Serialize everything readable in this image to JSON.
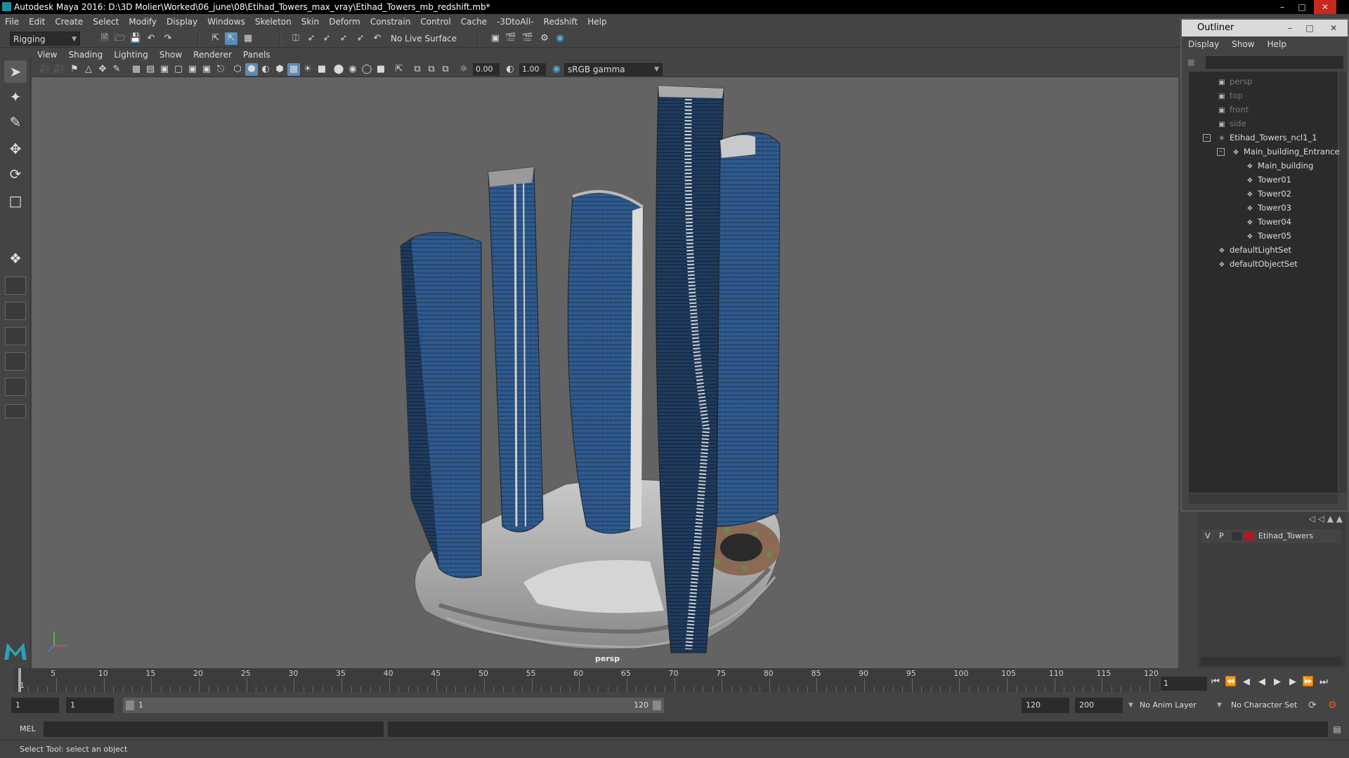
{
  "window": {
    "title": "Autodesk Maya 2016: D:\\3D Molier\\Worked\\06_june\\08\\Etihad_Towers_max_vray\\Etihad_Towers_mb_redshift.mb*"
  },
  "menubar": [
    "File",
    "Edit",
    "Create",
    "Select",
    "Modify",
    "Display",
    "Windows",
    "Skeleton",
    "Skin",
    "Deform",
    "Constrain",
    "Control",
    "Cache",
    "-3DtoAll-",
    "Redshift",
    "Help"
  ],
  "statusline": {
    "mode": "Rigging",
    "live_surface": "No Live Surface"
  },
  "viewport": {
    "menus": [
      "View",
      "Shading",
      "Lighting",
      "Show",
      "Renderer",
      "Panels"
    ],
    "exposure": "0.00",
    "gamma": "1.00",
    "colorspace": "sRGB gamma",
    "camera": "persp",
    "background": "#636363",
    "glass_color": "#2f5b8f"
  },
  "outliner": {
    "title": "Outliner",
    "menus": [
      "Display",
      "Show",
      "Help"
    ],
    "items": [
      {
        "label": "persp",
        "icon": "camera-icon"
      },
      {
        "label": "top",
        "icon": "camera-icon"
      },
      {
        "label": "front",
        "icon": "camera-icon"
      },
      {
        "label": "side",
        "icon": "camera-icon"
      },
      {
        "label": "Etihad_Towers_ncl1_1",
        "icon": "locator-icon"
      },
      {
        "label": "Main_building_Entrance",
        "icon": "group-icon"
      },
      {
        "label": "Main_building",
        "icon": "group-icon"
      },
      {
        "label": "Tower01",
        "icon": "group-icon"
      },
      {
        "label": "Tower02",
        "icon": "group-icon"
      },
      {
        "label": "Tower03",
        "icon": "group-icon"
      },
      {
        "label": "Tower04",
        "icon": "group-icon"
      },
      {
        "label": "Tower05",
        "icon": "group-icon"
      },
      {
        "label": "defaultLightSet",
        "icon": "set-icon"
      },
      {
        "label": "defaultObjectSet",
        "icon": "set-icon"
      }
    ]
  },
  "layers": {
    "v": "V",
    "p": "P",
    "name": "Etihad_Towers",
    "color": "#b5162b"
  },
  "timeline": {
    "ticks": [
      "1",
      "5",
      "10",
      "15",
      "20",
      "25",
      "30",
      "35",
      "40",
      "45",
      "50",
      "55",
      "60",
      "65",
      "70",
      "75",
      "80",
      "85",
      "90",
      "95",
      "100",
      "105",
      "110",
      "115",
      "120"
    ],
    "current_frame": "1"
  },
  "range": {
    "start": "1",
    "playback_start": "1",
    "slider_start": "1",
    "slider_end": "120",
    "playback_end": "120",
    "end": "200",
    "anim_layer": "No Anim Layer",
    "character_set": "No Character Set"
  },
  "command_line": {
    "label": "MEL"
  },
  "help_line": "Select Tool: select an object"
}
